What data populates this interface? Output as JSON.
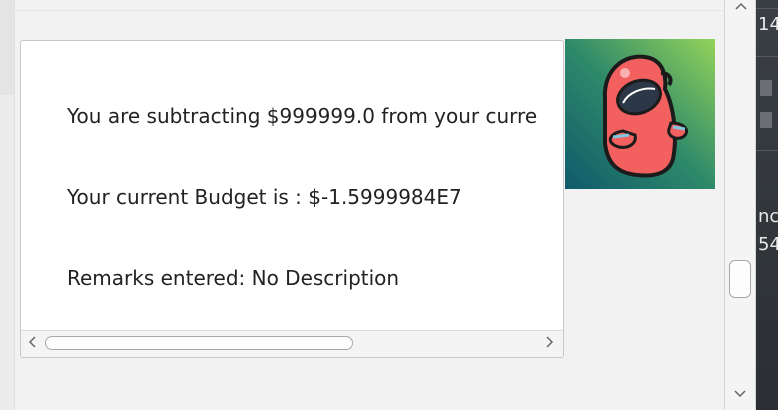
{
  "message": {
    "lines": [
      "You are subtracting $999999.0 from your curre",
      "Your current Budget is : $-1.5999984E7",
      "Remarks entered: No Description"
    ]
  },
  "avatar": {
    "icon": "red-bird-mascot-icon",
    "colors": {
      "bg_top": "#93d35a",
      "bg_bottom": "#0f5a6b",
      "body": "#f26060",
      "outline": "#1b1b1b",
      "eye": "#2c3747",
      "accent": "#7fc8e0"
    }
  },
  "scrollbars": {
    "h_left_arrow": "<",
    "h_right_arrow": ">",
    "v_up_arrow": "^",
    "v_down_arrow": "v"
  },
  "background_window": {
    "fragments": [
      "14",
      "nc",
      "54"
    ]
  }
}
